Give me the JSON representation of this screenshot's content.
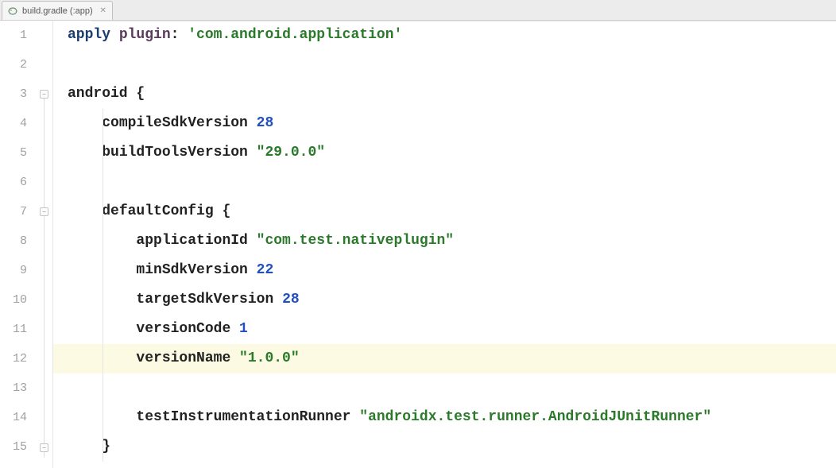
{
  "tab": {
    "icon_name": "gradle-icon",
    "label": "build.gradle (:app)"
  },
  "gutter": {
    "lines": [
      "1",
      "2",
      "3",
      "4",
      "5",
      "6",
      "7",
      "8",
      "9",
      "10",
      "11",
      "12",
      "13",
      "14",
      "15"
    ]
  },
  "code": {
    "l1": {
      "t1": "apply",
      "t2": "plugin",
      "t3": ": ",
      "t4": "'com.android.application'"
    },
    "l3": {
      "t1": "android {"
    },
    "l4": {
      "t1": "compileSdkVersion ",
      "t2": "28"
    },
    "l5": {
      "t1": "buildToolsVersion ",
      "t2": "\"29.0.0\""
    },
    "l7": {
      "t1": "defaultConfig {"
    },
    "l8": {
      "t1": "applicationId ",
      "t2": "\"com.test.nativeplugin\""
    },
    "l9": {
      "t1": "minSdkVersion ",
      "t2": "22"
    },
    "l10": {
      "t1": "targetSdkVersion ",
      "t2": "28"
    },
    "l11": {
      "t1": "versionCode ",
      "t2": "1"
    },
    "l12": {
      "t1": "versionName ",
      "t2": "\"1.0.0\""
    },
    "l14": {
      "t1": "testInstrumentationRunner ",
      "t2": "\"androidx.test.runner.AndroidJUnitRunner\""
    },
    "l15": {
      "t1": "}"
    }
  },
  "highlight_line": 12
}
